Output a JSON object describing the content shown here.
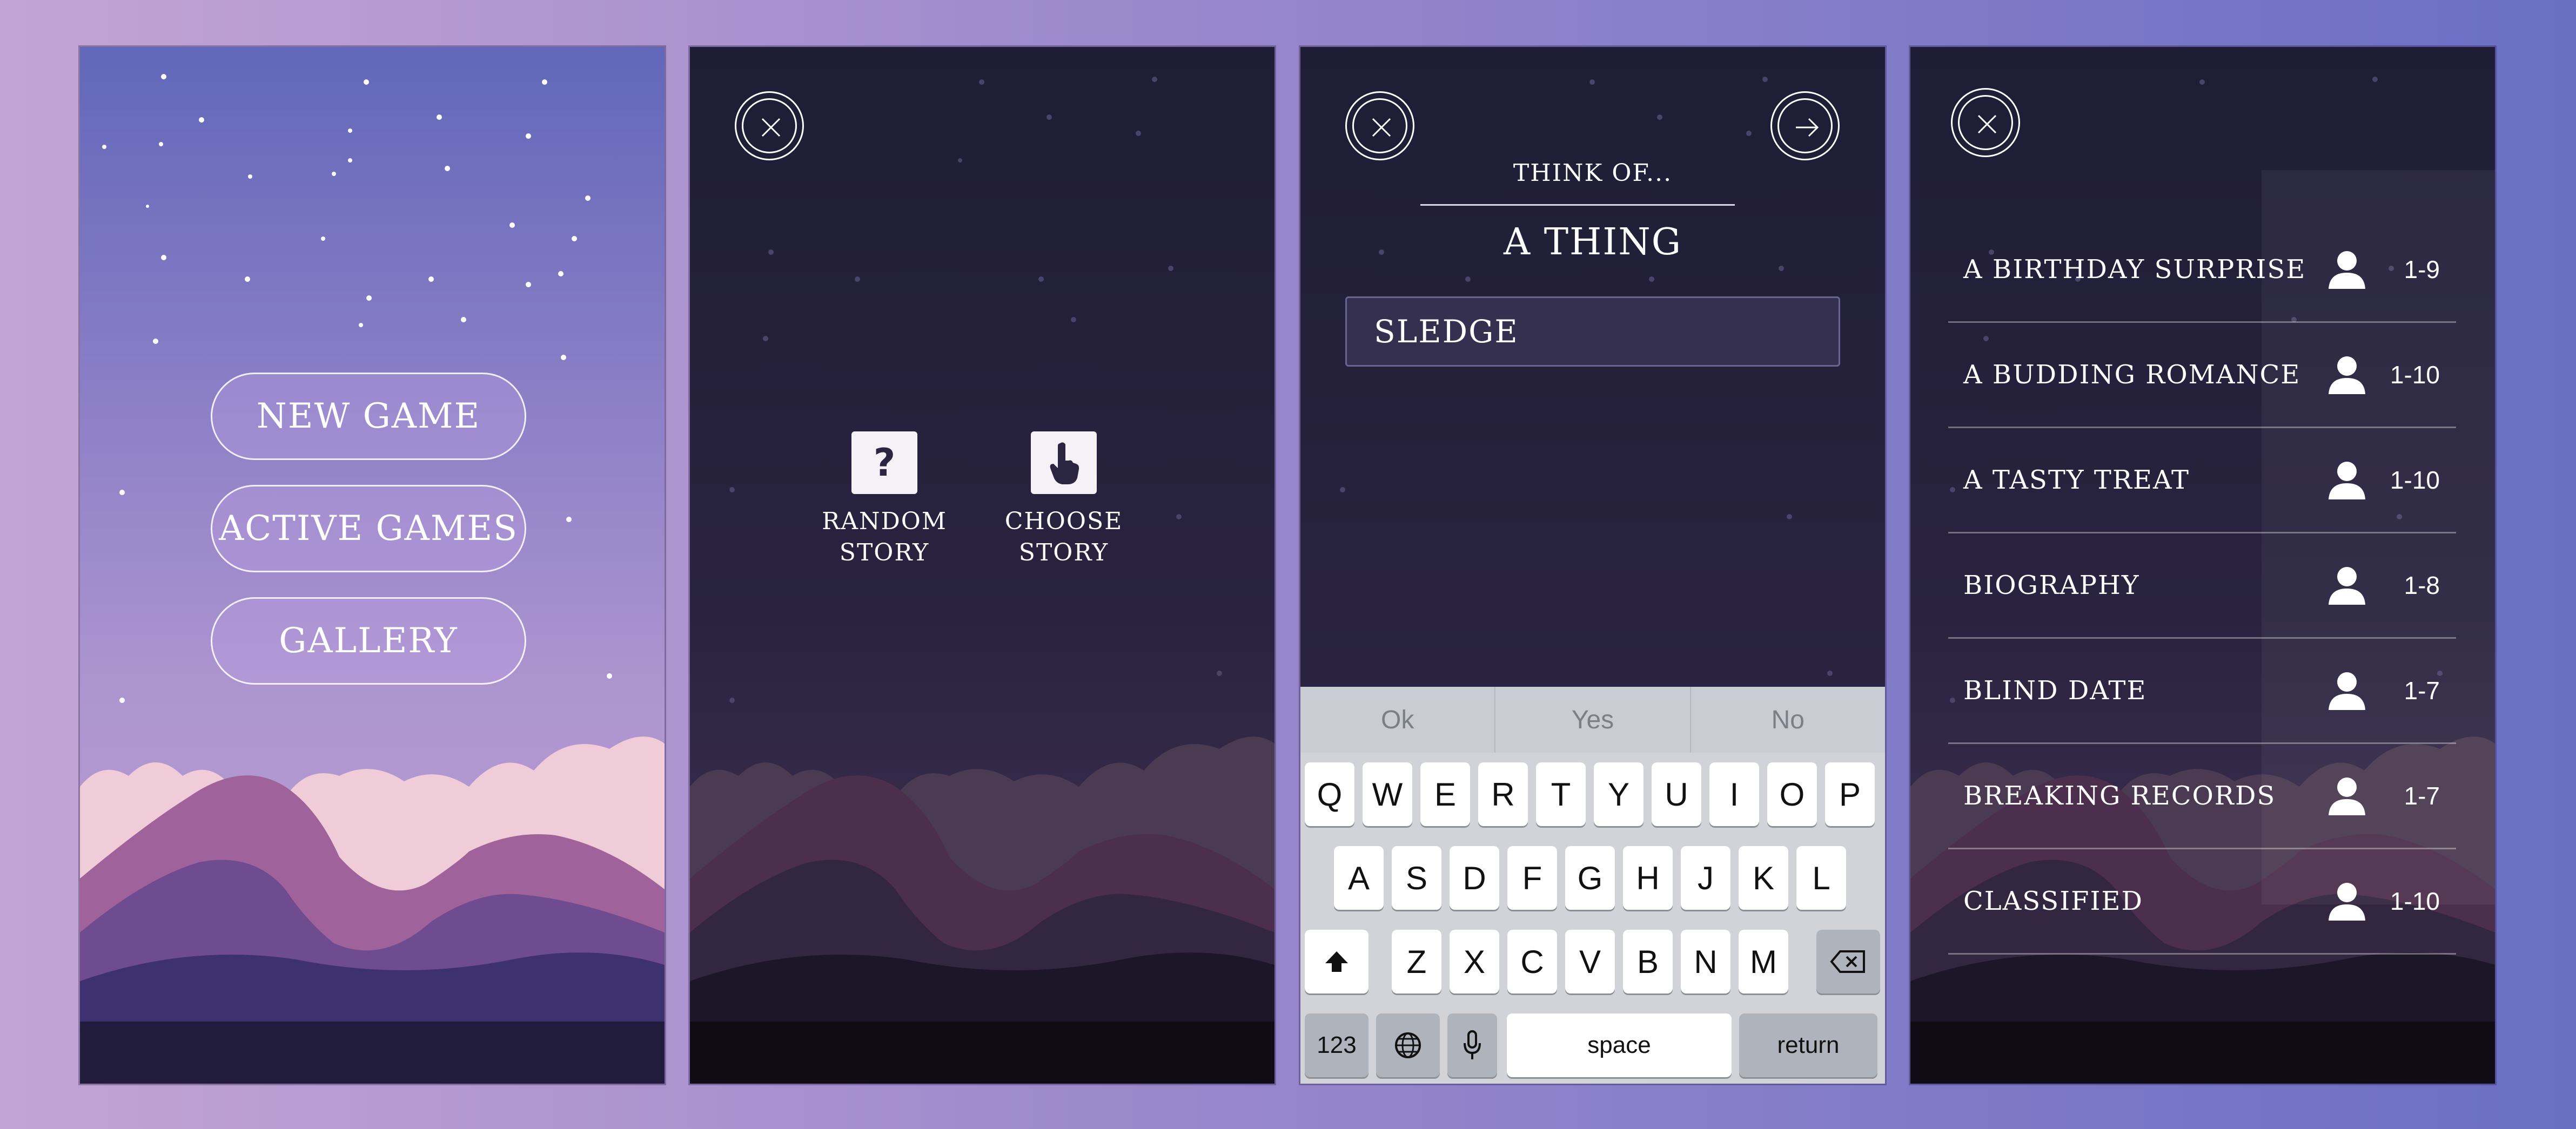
{
  "screen1": {
    "buttons": [
      "NEW GAME",
      "ACTIVE GAMES",
      "GALLERY"
    ]
  },
  "screen2": {
    "options": [
      {
        "label": "RANDOM\nSTORY",
        "icon": "question-mark-icon"
      },
      {
        "label": "CHOOSE\nSTORY",
        "icon": "pointing-hand-icon"
      }
    ]
  },
  "screen3": {
    "prompt": "THINK OF...",
    "subject": "A THING",
    "input_value": "SLEDGE",
    "suggestions": [
      "Ok",
      "Yes",
      "No"
    ],
    "keyboard": {
      "row1": [
        "Q",
        "W",
        "E",
        "R",
        "T",
        "Y",
        "U",
        "I",
        "O",
        "P"
      ],
      "row2": [
        "A",
        "S",
        "D",
        "F",
        "G",
        "H",
        "J",
        "K",
        "L"
      ],
      "row3": [
        "Z",
        "X",
        "C",
        "V",
        "B",
        "N",
        "M"
      ],
      "numbers_key": "123",
      "space_key": "space",
      "return_key": "return"
    }
  },
  "screen4": {
    "stories": [
      {
        "name": "A BIRTHDAY SURPRISE",
        "players": "1-9"
      },
      {
        "name": "A BUDDING ROMANCE",
        "players": "1-10"
      },
      {
        "name": "A TASTY TREAT",
        "players": "1-10"
      },
      {
        "name": "BIOGRAPHY",
        "players": "1-8"
      },
      {
        "name": "BLIND DATE",
        "players": "1-7"
      },
      {
        "name": "BREAKING RECORDS",
        "players": "1-7"
      },
      {
        "name": "CLASSIFIED",
        "players": "1-10"
      }
    ]
  },
  "colors": {
    "night_sky": "#1f1d35",
    "dusk_top": "#6167b9",
    "dusk_bottom": "#bda0d3",
    "hill_pink": "#a0629a",
    "cloud_pink": "#f2d0da",
    "keyboard_bg": "#d1d3d9"
  }
}
